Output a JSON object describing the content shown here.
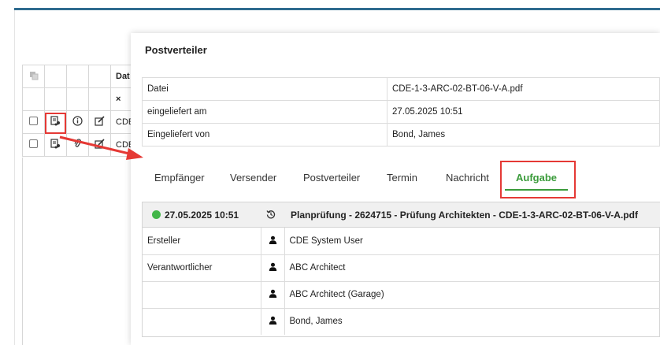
{
  "background_table": {
    "header": "Dat",
    "clear": "×",
    "rows": [
      {
        "text": "CDE"
      },
      {
        "text": "CDE"
      }
    ]
  },
  "modal": {
    "title": "Postverteiler",
    "info": [
      {
        "label": "Datei",
        "value": "CDE-1-3-ARC-02-BT-06-V-A.pdf"
      },
      {
        "label": "eingeliefert am",
        "value": "27.05.2025 10:51"
      },
      {
        "label": "Eingeliefert von",
        "value": "Bond, James"
      }
    ],
    "tabs": [
      {
        "label": "Empfänger"
      },
      {
        "label": "Versender"
      },
      {
        "label": "Postverteiler"
      },
      {
        "label": "Termin"
      },
      {
        "label": "Nachricht"
      },
      {
        "label": "Aufgabe",
        "active": true
      }
    ],
    "task": {
      "status_color": "#43b649",
      "date": "27.05.2025 10:51",
      "title": "Planprüfung - 2624715 - Prüfung Architekten - CDE-1-3-ARC-02-BT-06-V-A.pdf",
      "rows": [
        {
          "role": "Ersteller",
          "name": "CDE System User"
        },
        {
          "role": "Verantwortlicher",
          "name": "ABC Architect"
        },
        {
          "role": "",
          "name": "ABC Architect (Garage)"
        },
        {
          "role": "",
          "name": "Bond, James"
        }
      ]
    }
  },
  "colors": {
    "accent_green": "#3a9b3a",
    "highlight_red": "#e53935",
    "top_bar": "#2e6b8f"
  },
  "icons": {
    "copy": "copy-icon",
    "distribution": "distribution-list-icon",
    "info": "info-icon",
    "edit": "edit-icon",
    "attachment": "paperclip-icon",
    "history": "history-icon",
    "user": "user-icon"
  }
}
